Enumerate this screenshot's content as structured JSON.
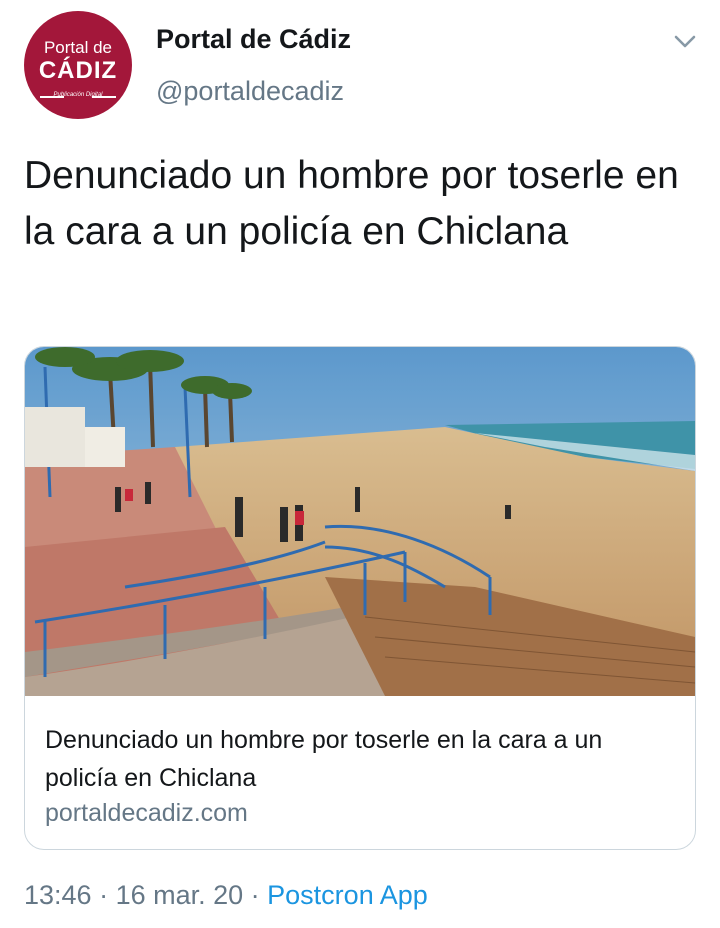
{
  "account": {
    "avatar_line1": "Portal de",
    "avatar_line2": "CÁDIZ",
    "avatar_line3": "Publicación Digital",
    "display_name": "Portal de Cádiz",
    "handle": "@portaldecadiz"
  },
  "tweet": {
    "text": "Denunciado un hombre por toserle en la cara a un policía en Chiclana"
  },
  "card": {
    "image_icon": "beach-promenade-photo",
    "title": "Denunciado un hombre por toserle en la cara a un policía en Chiclana",
    "domain": "portaldecadiz.com"
  },
  "meta": {
    "time": "13:46",
    "separator1": " · ",
    "date": "16 mar. 20",
    "separator2": " · ",
    "source_app": "Postcron App"
  },
  "colors": {
    "brand": "#a3173a",
    "link": "#1b95e0",
    "secondary_text": "#657786"
  }
}
